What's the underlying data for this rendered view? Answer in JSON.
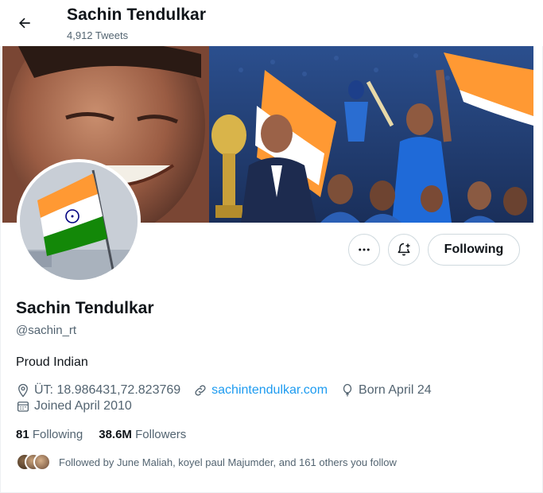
{
  "header": {
    "title": "Sachin Tendulkar",
    "tweet_count": "4,912 Tweets",
    "back_icon": "arrow-left-icon"
  },
  "profile": {
    "name": "Sachin Tendulkar",
    "handle": "@sachin_rt",
    "bio": "Proud Indian",
    "location": "ÜT: 18.986431,72.823769",
    "website": "sachintendulkar.com",
    "birthday": "Born April 24",
    "joined": "Joined April 2010"
  },
  "actions": {
    "more_icon": "more-dots-icon",
    "notify_icon": "bell-plus-icon",
    "following_label": "Following"
  },
  "stats": {
    "following_count": "81",
    "following_label": "Following",
    "followers_count": "38.6M",
    "followers_label": "Followers"
  },
  "followed_by": "Followed by June Maliah, koyel paul Majumder, and 161 others you follow",
  "colors": {
    "accent": "#1d9bf0",
    "text_secondary": "#536471",
    "saffron": "#ff9933",
    "green": "#138808",
    "navy": "#000080"
  }
}
